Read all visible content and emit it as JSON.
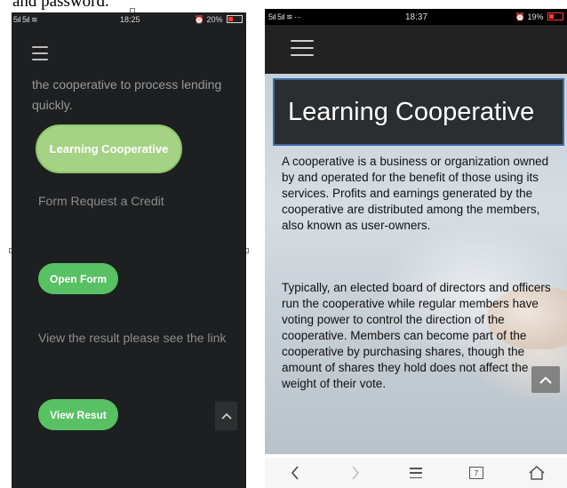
{
  "caption": "and password.",
  "left_phone": {
    "status": {
      "signal": "5ıl 5ıl ≋",
      "time": "18:25",
      "battery": "20%"
    },
    "intro_text": "the cooperative to process lending quickly.",
    "primary_button": "Learning Cooperative",
    "form_request_text": "Form Request a Credit",
    "open_form_button": "Open Form",
    "view_result_text": "View the result please see the link",
    "view_result_button": "View Resut",
    "colors": {
      "background": "#1d1f21",
      "primary_green": "#a6d286",
      "button_green": "#57c163"
    }
  },
  "right_phone": {
    "status": {
      "signal": "5ıl 5ıl ≋ ···",
      "time": "18:37",
      "battery": "19%"
    },
    "title": "Learning Cooperative",
    "paragraph1": "A cooperative is a business or organization owned by and operated for the benefit of those using its services. Profits and earnings generated by the cooperative are distributed among the members, also known as user-owners.",
    "paragraph2": "Typically, an elected board of directors and officers run the cooperative while regular members have voting power to control the direction of the cooperative. Members can become part of the cooperative by purchasing shares, though the amount of shares they hold does not affect the weight of their vote.",
    "tab_count": "7",
    "colors": {
      "header": "#222222",
      "title_bg": "#2b2e30",
      "title_border": "#3a6aa8"
    }
  },
  "icons": {
    "menu": "hamburger-icon",
    "scroll_top": "chevron-up-icon",
    "back": "chevron-left-icon",
    "forward": "chevron-right-icon",
    "nav_menu": "menu-lines-icon",
    "tabs": "tabs-icon",
    "home": "home-icon"
  }
}
